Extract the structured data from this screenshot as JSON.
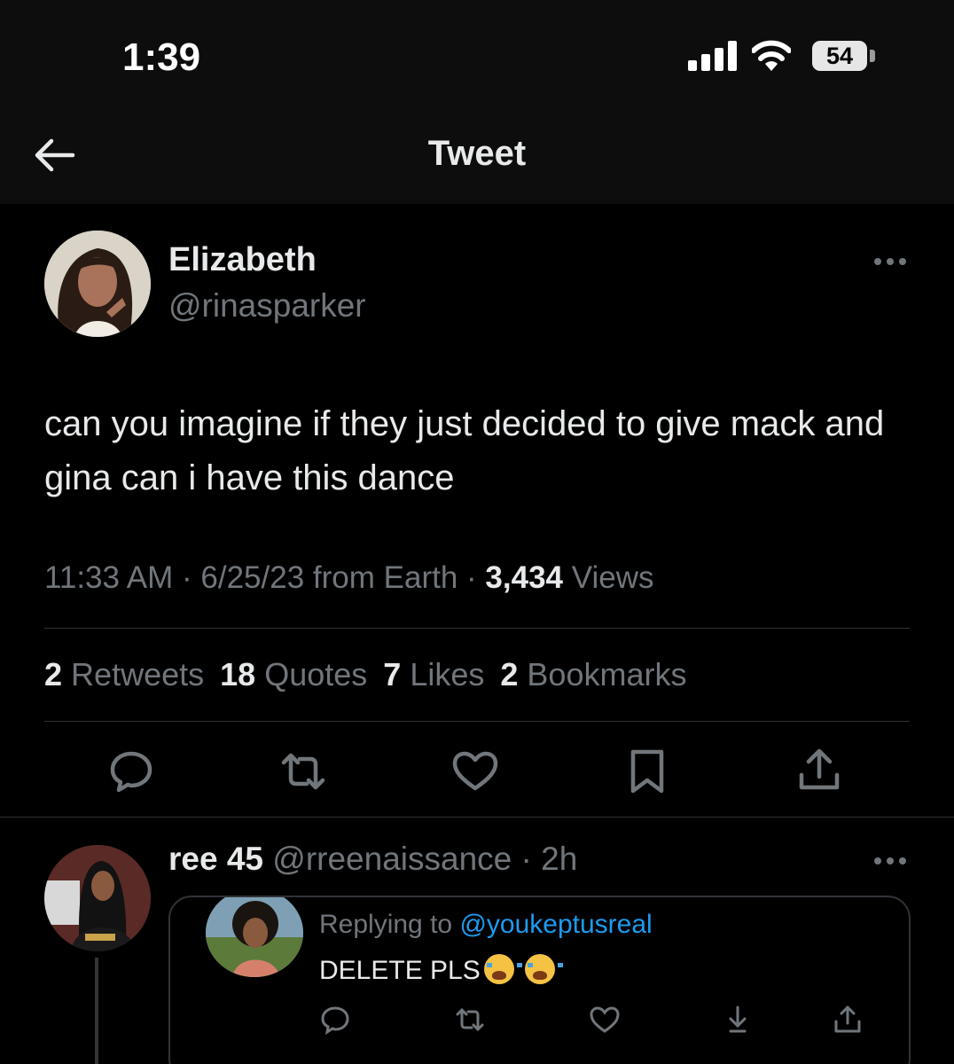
{
  "status_bar": {
    "time": "1:39",
    "battery": "54"
  },
  "header": {
    "title": "Tweet"
  },
  "tweet": {
    "author_name": "Elizabeth",
    "author_handle": "@rinasparker",
    "text": "can you imagine if they just decided to give mack and gina can i have this dance",
    "meta": {
      "time": "11:33 AM",
      "date_source": "6/25/23 from Earth",
      "views_count": "3,434",
      "views_label": "Views"
    },
    "stats": [
      {
        "count": "2",
        "label": "Retweets"
      },
      {
        "count": "18",
        "label": "Quotes"
      },
      {
        "count": "7",
        "label": "Likes"
      },
      {
        "count": "2",
        "label": "Bookmarks"
      }
    ],
    "actions": [
      "reply-icon",
      "retweet-icon",
      "like-icon",
      "bookmark-icon",
      "share-icon"
    ]
  },
  "reply": {
    "author_name": "ree 45",
    "author_handle": "@rreenaissance",
    "time": "2h",
    "quote": {
      "replying_prefix": "Replying to",
      "replying_handle": "@youkeptusreal",
      "text": "DELETE PLS"
    }
  },
  "colors": {
    "background": "#000000",
    "text": "#e7e9ea",
    "muted": "#71767b",
    "accent": "#1d9bf0",
    "divider": "#2f3336"
  }
}
